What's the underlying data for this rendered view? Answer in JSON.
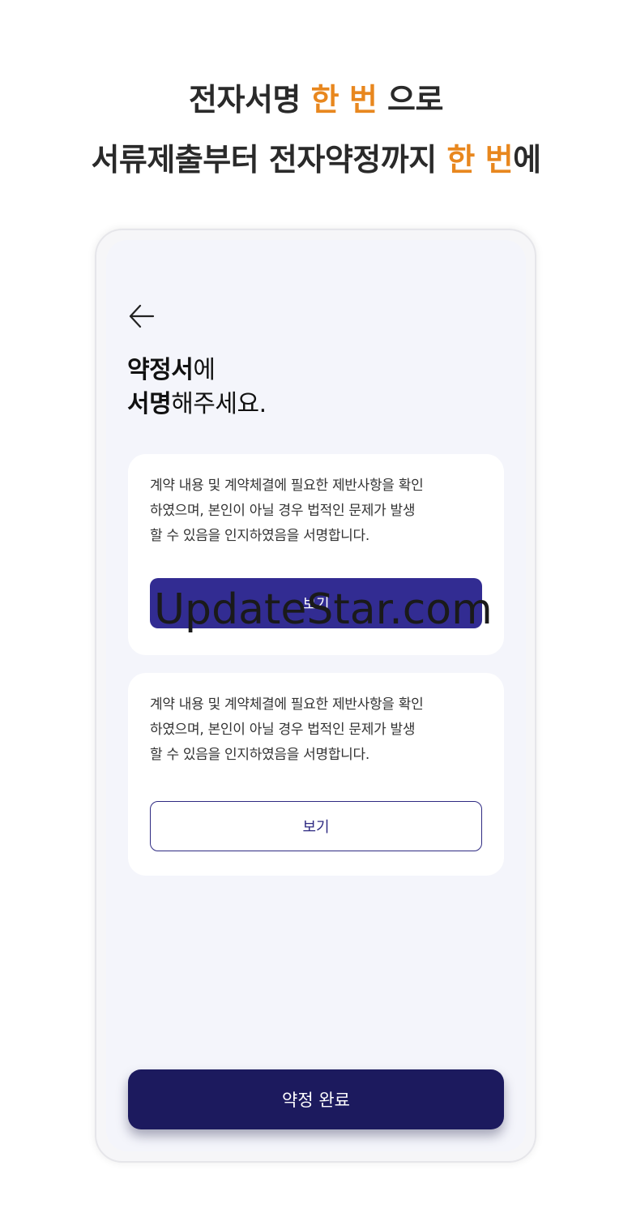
{
  "headline": {
    "line1": {
      "before": "전자서명 ",
      "accent": "한 번",
      "after": " 으로"
    },
    "line2": {
      "before": "서류제출부터 전자약정까지 ",
      "accent": "한 번",
      "after": "에"
    }
  },
  "colors": {
    "accent": "#e8871e",
    "primary_button": "#322c92",
    "complete_button": "#1c1a5e",
    "screen_bg": "#f4f5fb"
  },
  "screen": {
    "back_icon": "arrow-left-icon",
    "title": {
      "line1_bold": "약정서",
      "line1_rest": "에",
      "line2_bold": "서명",
      "line2_rest": "해주세요."
    },
    "cards": [
      {
        "text": "계약 내용 및 계약체결에 필요한 제반사항을 확인\n하였으며, 본인이 아닐 경우 법적인 문제가 발생\n할 수 있음을 인지하였음을 서명합니다.",
        "button_label": "보기"
      },
      {
        "text": "계약 내용 및 계약체결에 필요한 제반사항을 확인\n하였으며, 본인이 아닐 경우 법적인 문제가 발생\n할 수 있음을 인지하였음을 서명합니다.",
        "button_label": "보기"
      }
    ],
    "complete_button_label": "약정 완료"
  },
  "watermark": "UpdateStar.com"
}
